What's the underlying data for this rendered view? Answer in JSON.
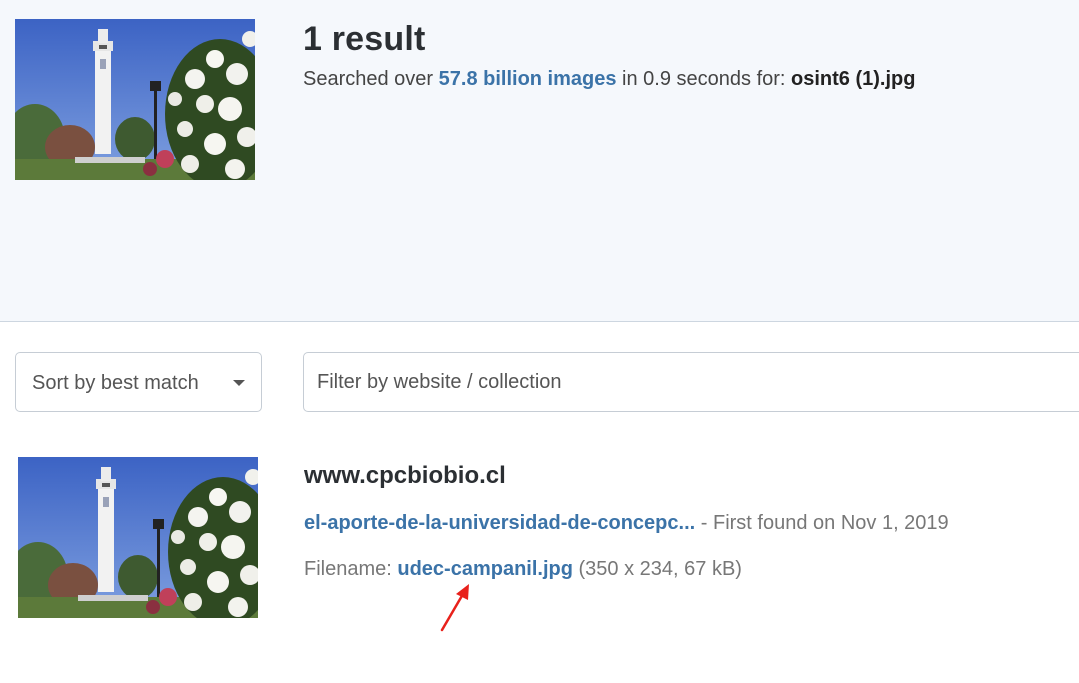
{
  "header": {
    "result_count": "1 result",
    "summary_prefix": "Searched over ",
    "summary_highlight": "57.8 billion images",
    "summary_middle": " in 0.9 seconds for: ",
    "query_filename": "osint6 (1).jpg",
    "query_image_icon": "campanile-photo"
  },
  "controls": {
    "sort_label": "Sort by best match",
    "filter_placeholder": "Filter by website / collection"
  },
  "results": [
    {
      "domain": "www.cpcbiobio.cl",
      "page_link": "el-aporte-de-la-universidad-de-concepc...",
      "first_found": " - First found on Nov 1, 2019",
      "filename_label": "Filename: ",
      "filename": "udec-campanil.jpg",
      "file_meta": " (350 x 234, 67 kB)"
    }
  ],
  "colors": {
    "link": "#3b73a8",
    "header_bg": "#f5f8fc",
    "annotation_arrow": "#e8211b"
  }
}
